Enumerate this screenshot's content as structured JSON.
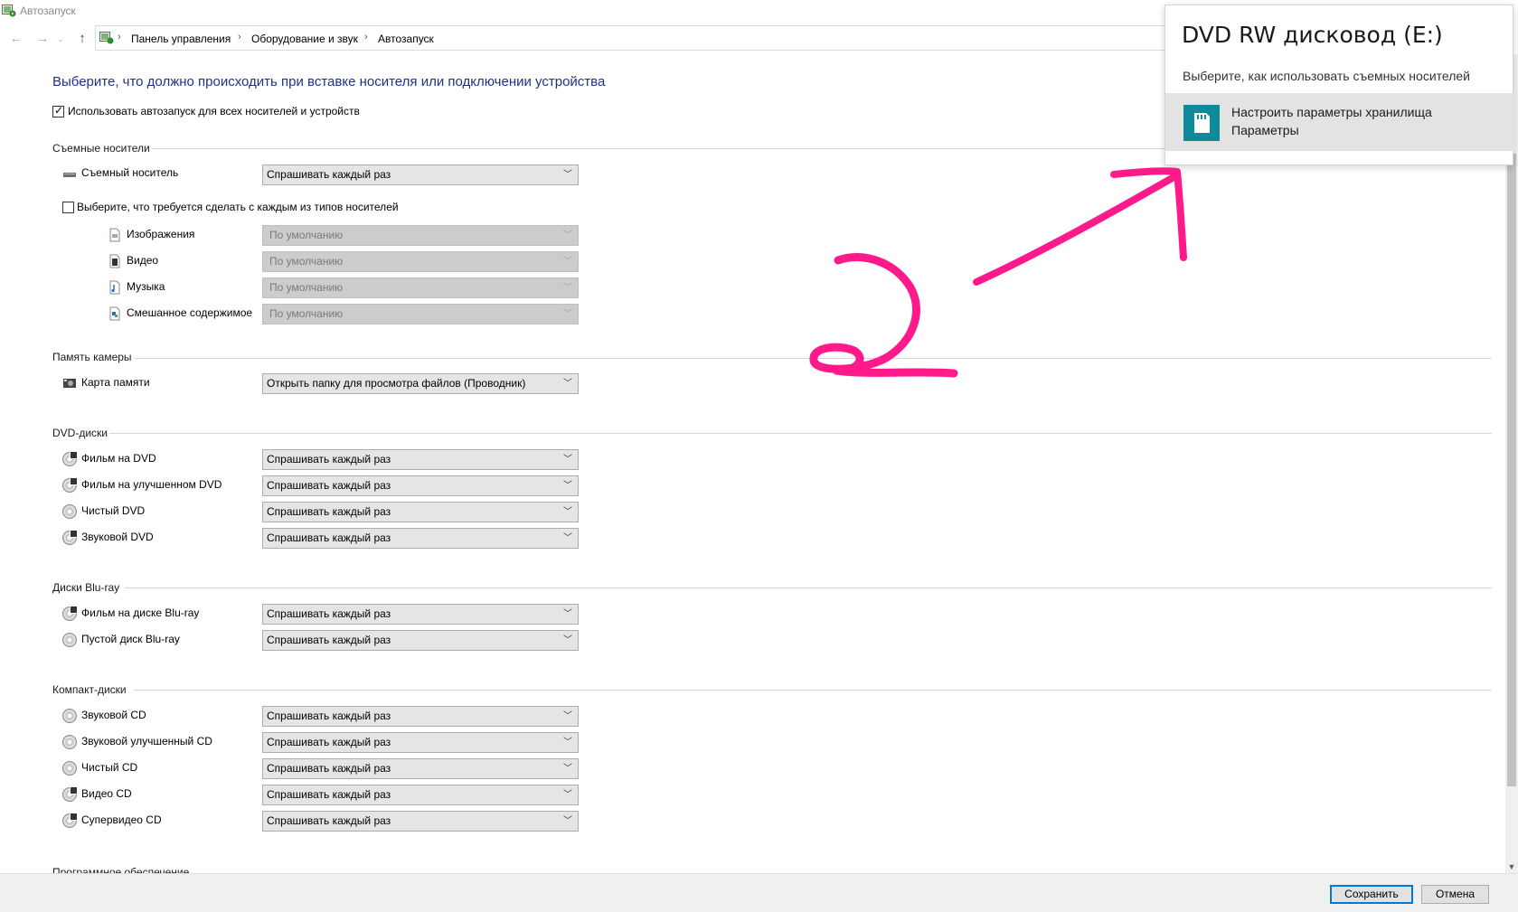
{
  "window": {
    "title": "Автозапуск"
  },
  "breadcrumb": [
    "Панель управления",
    "Оборудование и звук",
    "Автозапуск"
  ],
  "heading": "Выберите, что должно происходить при вставке носителя или подключении устройства",
  "use_autoplay": {
    "label": "Использовать автозапуск для всех носителей и устройств",
    "checked": true
  },
  "removable": {
    "title": "Съемные носители",
    "item_label": "Съемный носитель",
    "item_value": "Спрашивать каждый раз",
    "per_type": {
      "label": "Выберите, что требуется сделать с каждым из типов носителей",
      "checked": false
    },
    "types": [
      {
        "label": "Изображения",
        "value": "По умолчанию",
        "icon": "image-file-icon"
      },
      {
        "label": "Видео",
        "value": "По умолчанию",
        "icon": "video-file-icon"
      },
      {
        "label": "Музыка",
        "value": "По умолчанию",
        "icon": "music-file-icon"
      },
      {
        "label": "Смешанное содержимое",
        "value": "По умолчанию",
        "icon": "mixed-file-icon"
      }
    ]
  },
  "camera": {
    "title": "Память камеры",
    "items": [
      {
        "label": "Карта памяти",
        "value": "Открыть папку для просмотра файлов (Проводник)"
      }
    ]
  },
  "dvd": {
    "title": "DVD-диски",
    "items": [
      {
        "label": "Фильм на DVD",
        "value": "Спрашивать каждый раз"
      },
      {
        "label": "Фильм на улучшенном DVD",
        "value": "Спрашивать каждый раз"
      },
      {
        "label": "Чистый DVD",
        "value": "Спрашивать каждый раз"
      },
      {
        "label": "Звуковой DVD",
        "value": "Спрашивать каждый раз"
      }
    ]
  },
  "bluray": {
    "title": "Диски Blu-ray",
    "items": [
      {
        "label": "Фильм на диске Blu-ray",
        "value": "Спрашивать каждый раз"
      },
      {
        "label": "Пустой диск Blu-ray",
        "value": "Спрашивать каждый раз"
      }
    ]
  },
  "cd": {
    "title": "Компакт-диски",
    "items": [
      {
        "label": "Звуковой CD",
        "value": "Спрашивать каждый раз"
      },
      {
        "label": "Звуковой улучшенный CD",
        "value": "Спрашивать каждый раз"
      },
      {
        "label": "Чистый CD",
        "value": "Спрашивать каждый раз"
      },
      {
        "label": "Видео CD",
        "value": "Спрашивать каждый раз"
      },
      {
        "label": "Супервидео CD",
        "value": "Спрашивать каждый раз"
      }
    ]
  },
  "software": {
    "title": "Программное обеспечение"
  },
  "footer": {
    "save": "Сохранить",
    "cancel": "Отмена"
  },
  "toast": {
    "title": "DVD RW дисковод (E:)",
    "subtitle": "Выберите, как использовать съемных носителей",
    "option_line1": "Настроить параметры хранилища",
    "option_line2": "Параметры"
  },
  "annotation": {
    "color": "#ff1a8c"
  }
}
